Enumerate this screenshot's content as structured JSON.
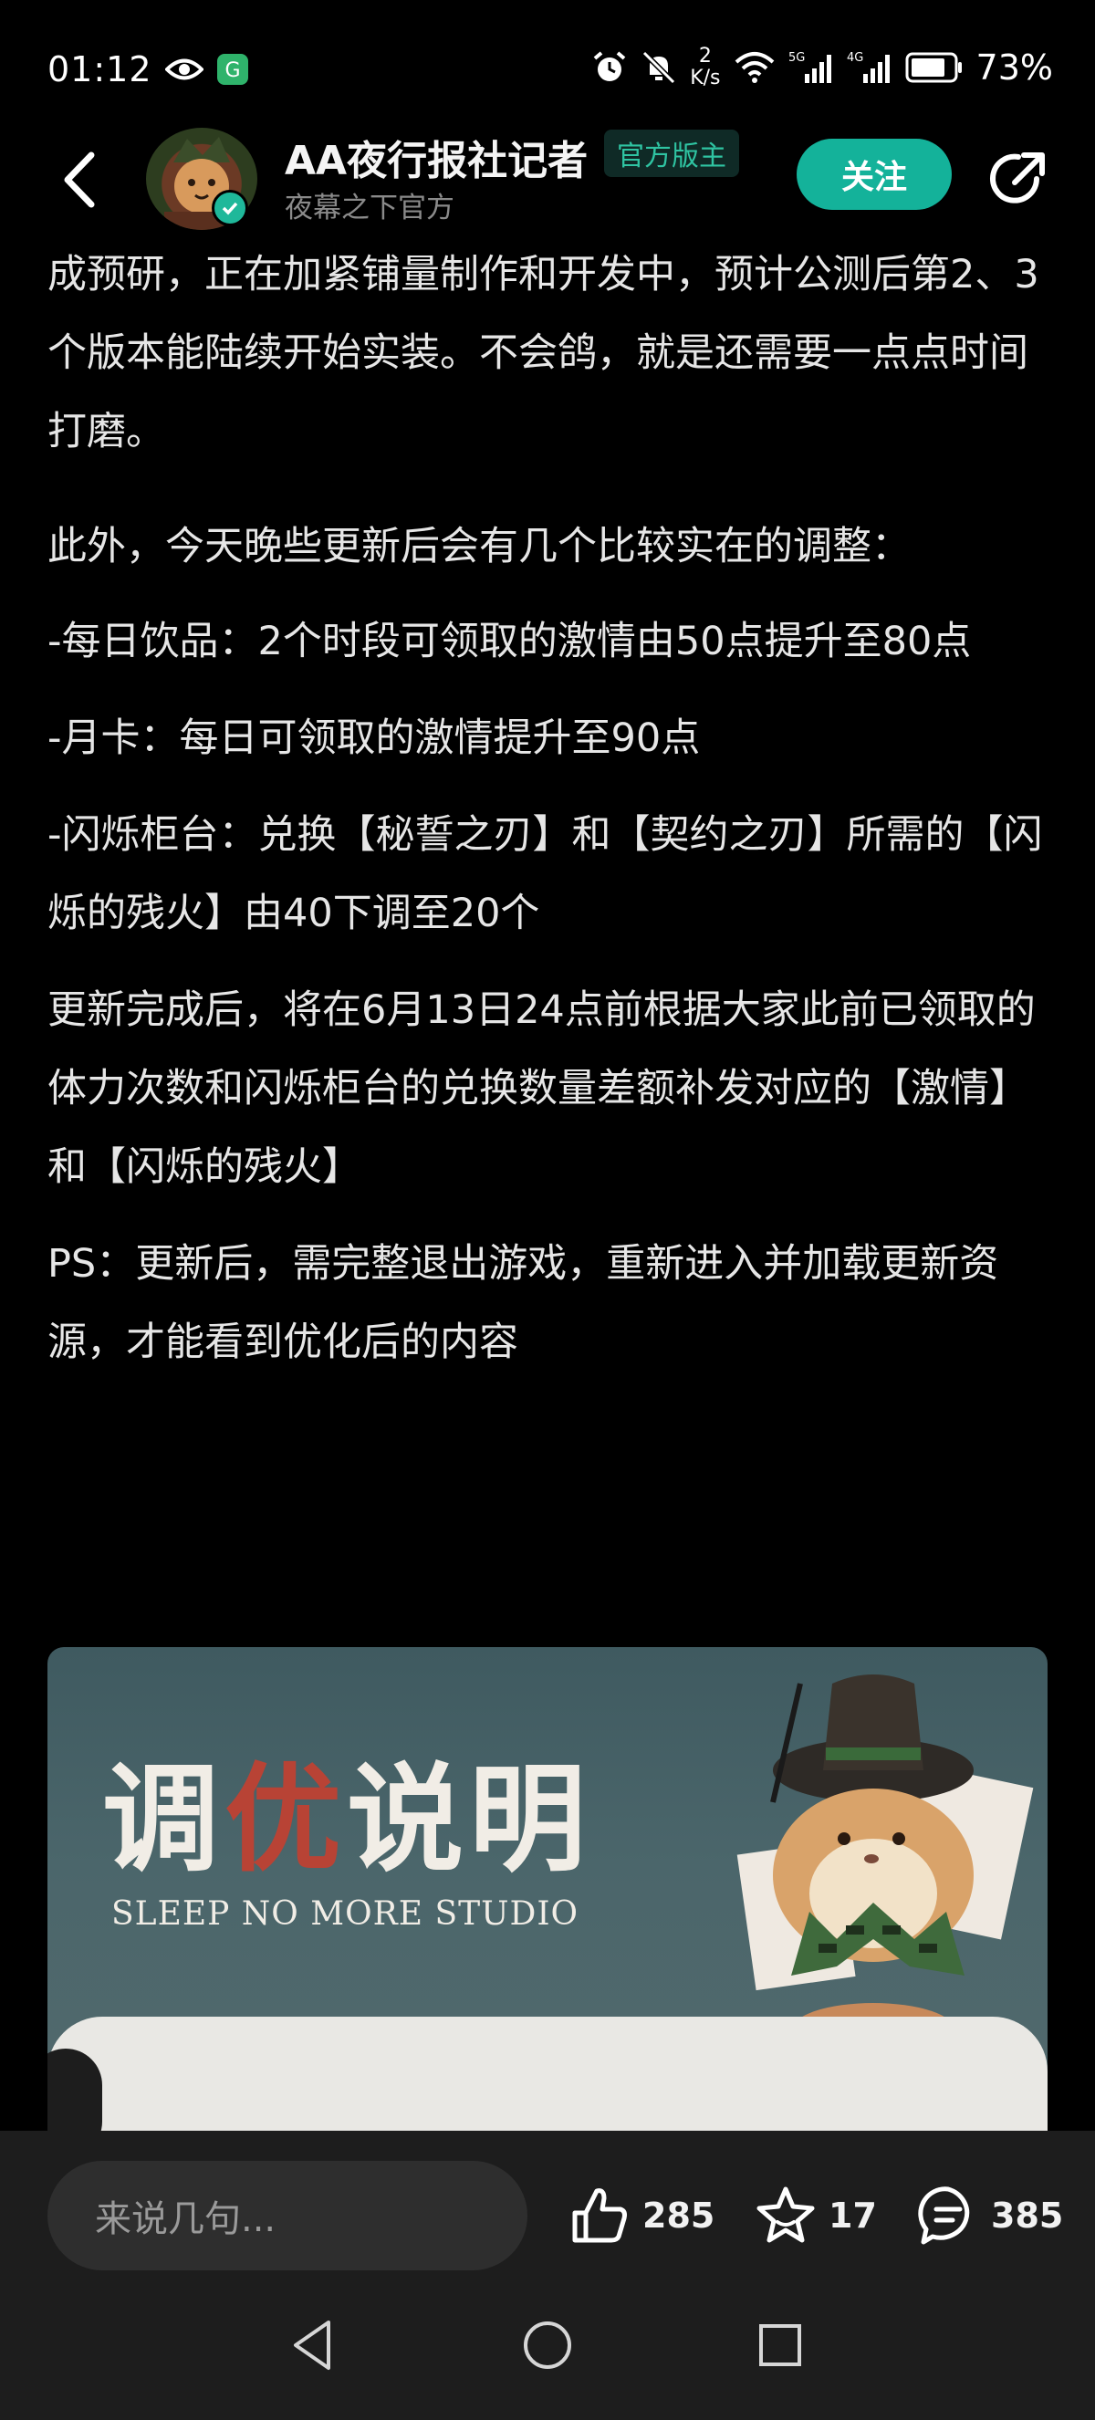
{
  "status_bar": {
    "time": "01:12",
    "net_speed_value": "2",
    "net_speed_unit": "K/s",
    "signal_1": "5G",
    "signal_2": "4G",
    "battery": "73%"
  },
  "header": {
    "author_name": "AA夜行报社记者",
    "author_tag": "官方版主",
    "author_subtitle": "夜幕之下官方",
    "follow_label": "关注"
  },
  "article": {
    "paragraphs": [
      "成预研，正在加紧铺量制作和开发中，预计公测后第2、3个版本能陆续开始实装。不会鸽，就是还需要一点点时间打磨。",
      "此外，今天晚些更新后会有几个比较实在的调整：",
      "-每日饮品：2个时段可领取的激情由50点提升至80点",
      "-月卡：每日可领取的激情提升至90点",
      "-闪烁柜台：兑换【秘誓之刃】和【契约之刃】所需的【闪烁的残火】由40下调至20个",
      "更新完成后，将在6月13日24点前根据大家此前已领取的体力次数和闪烁柜台的兑换数量差额补发对应的【激情】和【闪烁的残火】",
      "PS：更新后，需完整退出游戏，重新进入并加载更新资源，才能看到优化后的内容"
    ]
  },
  "banner": {
    "title_part1": "调",
    "title_accent": "优",
    "title_part2": "说明",
    "subtitle": "SLEEP NO MORE STUDIO"
  },
  "action_bar": {
    "comment_placeholder": "来说几句...",
    "likes": "285",
    "favorites": "17",
    "comments": "385"
  },
  "icons": {
    "back": "back-arrow-icon",
    "share": "share-icon",
    "like": "thumbs-up-icon",
    "favorite": "star-icon",
    "comment": "comment-bubble-icon"
  },
  "colors": {
    "accent": "#14b29a",
    "tag_text": "#2fc4a2",
    "background": "#000000"
  }
}
